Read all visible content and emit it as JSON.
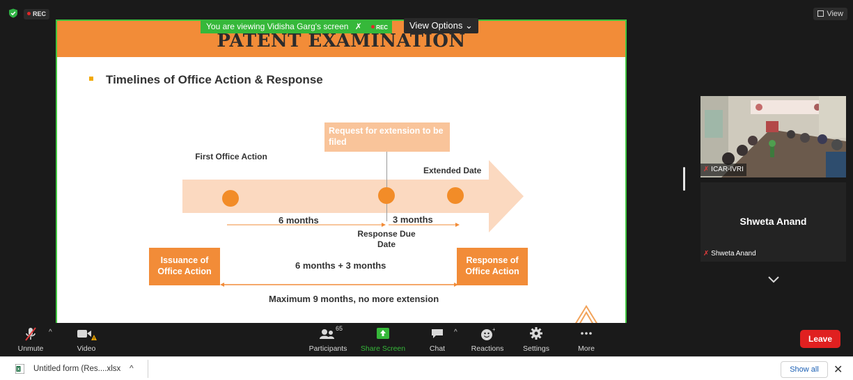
{
  "status": {
    "rec_label": "REC",
    "view_label": "View"
  },
  "share": {
    "banner_text": "You are viewing Vidisha Garg's screen",
    "banner_rec": "REC",
    "view_options_label": "View Options"
  },
  "slide": {
    "title": "PATENT EXAMINATION",
    "heading": "Timelines of Office Action & Response",
    "first_office_action": "First Office Action",
    "request_extension": "Request for extension to be filed",
    "extended_date": "Extended Date",
    "six_months": "6 months",
    "three_months": "3 months",
    "response_due_date": "Response Due Date",
    "issuance": "Issuance of Office Action",
    "response_of_office_action": "Response of Office Action",
    "sum_label": "6 months + 3 months",
    "max_label": "Maximum 9 months, no more extension"
  },
  "participants_panel": {
    "video_label": "ICAR-IVRI",
    "tile_name": "Shweta Anand",
    "tile_label": "Shweta Anand"
  },
  "toolbar": {
    "unmute": "Unmute",
    "video": "Video",
    "participants": "Participants",
    "participants_count": "65",
    "share_screen": "Share Screen",
    "chat": "Chat",
    "reactions": "Reactions",
    "settings": "Settings",
    "more": "More",
    "leave": "Leave"
  },
  "download_bar": {
    "file_name": "Untitled form (Res....xlsx",
    "show_all": "Show all"
  },
  "colors": {
    "accent_orange": "#f28c38",
    "share_green": "#36b83a",
    "leave_red": "#e02020"
  }
}
